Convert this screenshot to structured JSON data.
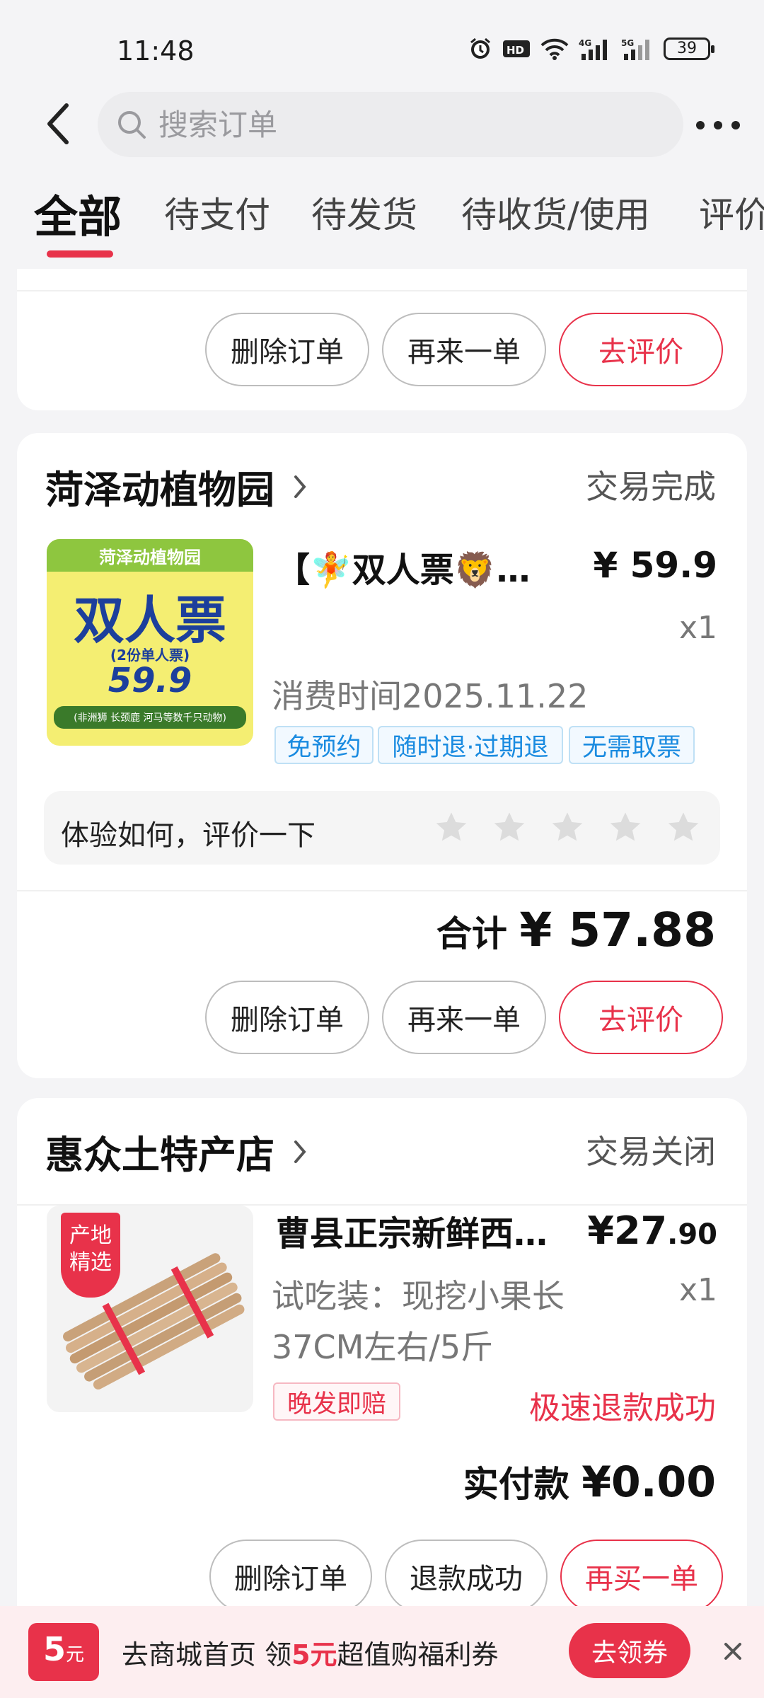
{
  "status_bar": {
    "time": "11:48",
    "battery": "39",
    "network": "4G",
    "network2": "5G",
    "hd": "HD"
  },
  "header": {
    "search_placeholder": "搜索订单"
  },
  "tabs": [
    "全部",
    "待支付",
    "待发货",
    "待收货/使用",
    "评价"
  ],
  "active_tab": "全部",
  "top_card": {
    "buttons": {
      "delete": "删除订单",
      "reorder": "再来一单",
      "review": "去评价"
    }
  },
  "order1": {
    "shop": "菏泽动植物园",
    "status": "交易完成",
    "thumb": {
      "brand": "菏泽动植物园",
      "big": "双人票",
      "sub": "(2份单人票)",
      "price": "59.9",
      "foot": "(非洲狮 长颈鹿 河马等数千只动物)"
    },
    "title": "【🧚双人票🦁…",
    "price": "¥ 59.9",
    "qty": "x1",
    "consume_time": "消费时间2025.11.22",
    "tags": [
      "免预约",
      "随时退·过期退",
      "无需取票"
    ],
    "review_prompt": "体验如何，评价一下",
    "star_count": 5,
    "total_label": "合计",
    "total_value": "¥ 57.88",
    "buttons": {
      "delete": "删除订单",
      "reorder": "再来一单",
      "review": "去评价"
    }
  },
  "order2": {
    "shop": "惠众土特产店",
    "status": "交易关闭",
    "thumb_badge": "产地精选",
    "title": "曹县正宗新鲜西…",
    "price_main": "¥27",
    "price_dec": ".90",
    "spec_line1": "试吃装：现挖小果长",
    "spec_line2": "37CM左右/5斤",
    "qty": "x1",
    "tag": "晚发即赔",
    "refund_status": "极速退款成功",
    "paid_label": "实付款",
    "paid_value": "¥0.00",
    "buttons": {
      "delete": "删除订单",
      "refund": "退款成功",
      "rebuy": "再买一单"
    }
  },
  "coupon_bar": {
    "badge_amount": "5",
    "badge_unit": "元",
    "text_prefix": "去商城首页 领",
    "text_highlight": "5元",
    "text_suffix": "超值购福利券",
    "button": "去领券"
  },
  "colors": {
    "accent": "#e8324a",
    "tag_blue": "#1a8be0",
    "background": "#f4f4f6"
  }
}
